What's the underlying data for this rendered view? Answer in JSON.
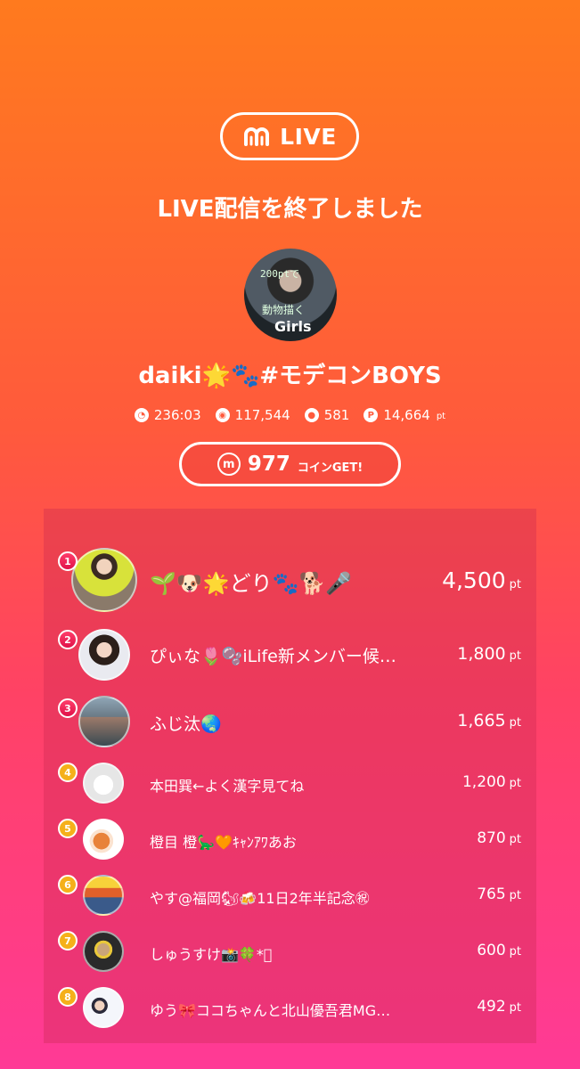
{
  "app": {
    "brand_label": "LIVE"
  },
  "header": {
    "title": "LIVE配信を終了しました"
  },
  "streamer": {
    "name": "daiki🌟🐾#モデコンBOYS",
    "avatar_text": [
      "200ptで",
      "動物描く",
      "Girls"
    ]
  },
  "stats": [
    {
      "icon": "clock-icon",
      "value": "236:03",
      "unit": ""
    },
    {
      "icon": "viewers-icon",
      "value": "117,544",
      "unit": ""
    },
    {
      "icon": "comment-icon",
      "value": "581",
      "unit": ""
    },
    {
      "icon": "points-icon",
      "value": "14,664",
      "unit": "pt"
    }
  ],
  "coins": {
    "icon": "m",
    "value": "977",
    "label": "コインGET!"
  },
  "ranking": [
    {
      "rank": "1",
      "name": "🌱🐶🌟どり🐾🐕🎤",
      "points": "4,500",
      "unit": "pt"
    },
    {
      "rank": "2",
      "name": "ぴぃな🌷🫧iLife新メンバー候…",
      "points": "1,800",
      "unit": "pt"
    },
    {
      "rank": "3",
      "name": "ふじ汰🌏",
      "points": "1,665",
      "unit": "pt"
    },
    {
      "rank": "4",
      "name": "本田巽←よく漢字見てね",
      "points": "1,200",
      "unit": "pt"
    },
    {
      "rank": "5",
      "name": "橙目 橙🦕🧡ｷｬﾝｱﾜあお",
      "points": "870",
      "unit": "pt"
    },
    {
      "rank": "6",
      "name": "やす@福岡🐿🍻11日2年半記念㊗",
      "points": "765",
      "unit": "pt"
    },
    {
      "rank": "7",
      "name": "しゅうすけ📸🍀*ﾟ",
      "points": "600",
      "unit": "pt"
    },
    {
      "rank": "8",
      "name": "ゆう🎀ココちゃんと北山優吾君MG…",
      "points": "492",
      "unit": "pt"
    }
  ]
}
